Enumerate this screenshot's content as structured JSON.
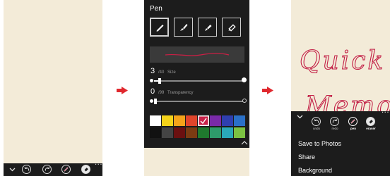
{
  "panel_pen_settings": {
    "title": "Pen",
    "pen_types": [
      "pen-type-1",
      "pen-type-2",
      "pen-type-3",
      "pen-type-4"
    ],
    "selected_pen_index": 0,
    "size": {
      "value": "3",
      "max": "/40",
      "label": "Size",
      "fraction": 0.06
    },
    "transparency": {
      "value": "0",
      "max": "/99",
      "label": "Transparency",
      "fraction": 0.0
    },
    "stroke_color": "#cc1f45",
    "palette": [
      [
        "#ffffff",
        "#f5d31a",
        "#f5a31a",
        "#e0452b",
        "#c8234a",
        "#7a2aa8",
        "#2f3fb0",
        "#2a70c8"
      ],
      [
        "#111111",
        "#444444",
        "#6b1010",
        "#7b3b12",
        "#1f7a2e",
        "#2e9a6a",
        "#2aa8b8",
        "#7cc242"
      ]
    ],
    "selected_swatch": [
      0,
      4
    ]
  },
  "panel_memo": {
    "handwriting_line1": "Quick",
    "handwriting_line2": "Memo",
    "toolbar": [
      {
        "icon": "undo-icon",
        "label": "undo"
      },
      {
        "icon": "redo-icon",
        "label": "redo"
      },
      {
        "icon": "pen-icon",
        "label": "pen",
        "active": true
      },
      {
        "icon": "eraser-icon",
        "label": "eraser",
        "active": true
      }
    ],
    "menu_items": [
      "Save to Photos",
      "Share",
      "Background"
    ]
  },
  "more_glyph": "···",
  "colors": {
    "paper": "#f3ebd8",
    "sheet": "#1c1c1c",
    "arrow": "#e0282e",
    "ink": "#c21e45"
  }
}
